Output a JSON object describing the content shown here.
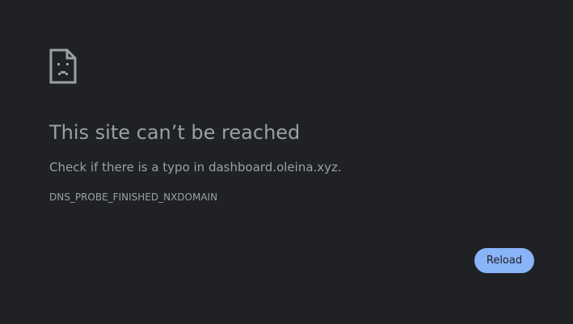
{
  "error_page": {
    "icon": "sad-document-icon",
    "title": "This site can’t be reached",
    "message": "Check if there is a typo in dashboard.oleina.xyz.",
    "error_code": "DNS_PROBE_FINISHED_NXDOMAIN",
    "reload_label": "Reload"
  },
  "colors": {
    "background": "#202124",
    "text": "#9aa0a6",
    "button": "#8ab4f8",
    "button_text": "#202124"
  }
}
